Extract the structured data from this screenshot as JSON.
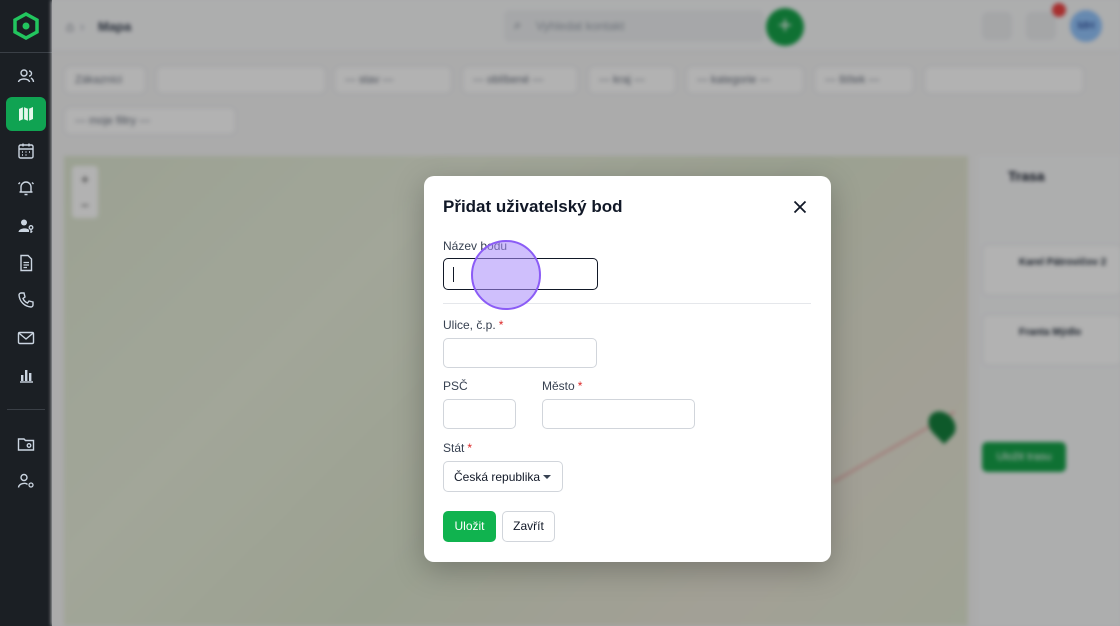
{
  "colors": {
    "accent": "#10b34f",
    "sidebar_bg": "#1b1f24",
    "required_mark": "#dc2626",
    "focus_ring": "#8b5cf6"
  },
  "sidebar": {
    "items": [
      {
        "icon": "users-icon"
      },
      {
        "icon": "map-icon",
        "active": true
      },
      {
        "icon": "calendar-icon"
      },
      {
        "icon": "bell-icon"
      },
      {
        "icon": "user-key-icon"
      },
      {
        "icon": "document-icon"
      },
      {
        "icon": "phone-icon"
      },
      {
        "icon": "mail-icon"
      },
      {
        "icon": "bar-chart-icon"
      },
      {
        "icon": "folder-settings-icon"
      },
      {
        "icon": "user-settings-icon"
      }
    ]
  },
  "background": {
    "breadcrumb": "Mapa",
    "search_placeholder": "Vyhledat kontakt",
    "avatar_initials": "MH",
    "filters": [
      "Zákazníci",
      "--- stav ---",
      "--- oblíbené ---",
      "--- kraj ---",
      "--- kategorie ---",
      "--- štítek ---",
      "--- moje filtry ---"
    ],
    "route_panel_title": "Trasa",
    "route_cards": [
      "Karel Pátrovičov 2",
      "Franta Mýdlo"
    ],
    "route_button": "Uložit trasu"
  },
  "modal": {
    "title": "Přidat uživatelský bod",
    "fields": {
      "name": {
        "label": "Název bodu",
        "value": ""
      },
      "street": {
        "label": "Ulice, č.p.",
        "value": ""
      },
      "zip": {
        "label": "PSČ",
        "value": ""
      },
      "city": {
        "label": "Město",
        "value": ""
      },
      "country": {
        "label": "Stát",
        "value": "Česká republika"
      }
    },
    "required_mark": "*",
    "save_label": "Uložit",
    "close_label": "Zavřít"
  }
}
